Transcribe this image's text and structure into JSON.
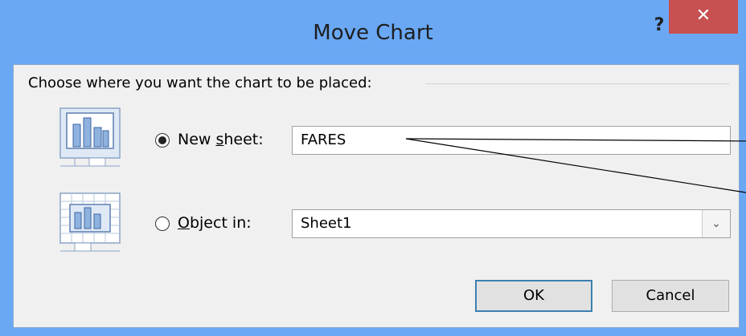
{
  "dialog": {
    "title": "Move Chart",
    "help_label": "?",
    "close_label": "✕"
  },
  "prompt": "Choose where you want the chart to be placed:",
  "options": {
    "new_sheet": {
      "label_pre": "New ",
      "label_accel": "s",
      "label_post": "heet:",
      "selected": true,
      "value": "FARES"
    },
    "object_in": {
      "label_accel": "O",
      "label_post": "bject in:",
      "selected": false,
      "value": "Sheet1"
    }
  },
  "buttons": {
    "ok_label": "OK",
    "cancel_label": "Cancel"
  },
  "icons": {
    "new_sheet": "new-sheet-chart-icon",
    "object_in": "object-in-chart-icon",
    "dropdown": "chevron-down-icon"
  },
  "colors": {
    "titlebar": "#6aa8f4",
    "close_button": "#c75050",
    "client": "#f0f0f0"
  }
}
